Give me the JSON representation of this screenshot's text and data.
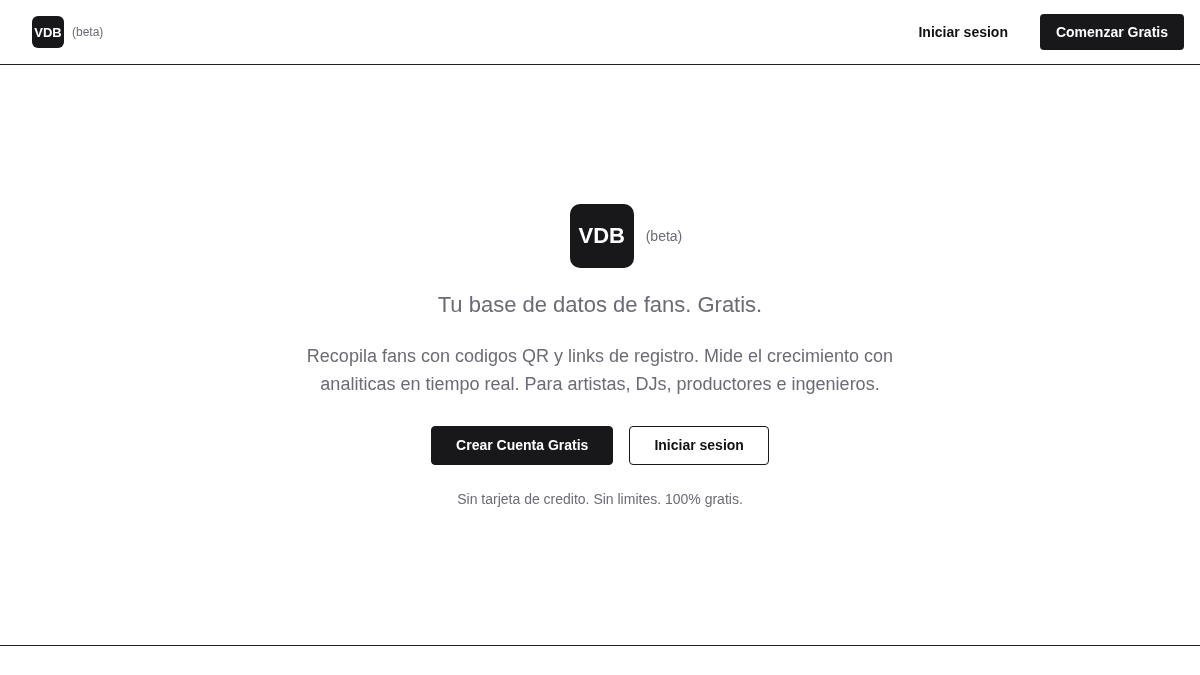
{
  "header": {
    "logo": "VDB",
    "badge": "(beta)",
    "login_link": "Iniciar sesion",
    "cta_button": "Comenzar Gratis"
  },
  "hero": {
    "logo": "VDB",
    "badge": "(beta)",
    "headline": "Tu base de datos de fans. Gratis.",
    "description": "Recopila fans con codigos QR y links de registro. Mide el crecimiento con analiticas en tiempo real. Para artistas, DJs, productores e ingenieros.",
    "buttons": [
      {
        "label": "Crear Cuenta Gratis",
        "kind": "primary"
      },
      {
        "label": "Iniciar sesion",
        "kind": "outline"
      }
    ],
    "note": "Sin tarjeta de credito. Sin limites. 100% gratis."
  }
}
